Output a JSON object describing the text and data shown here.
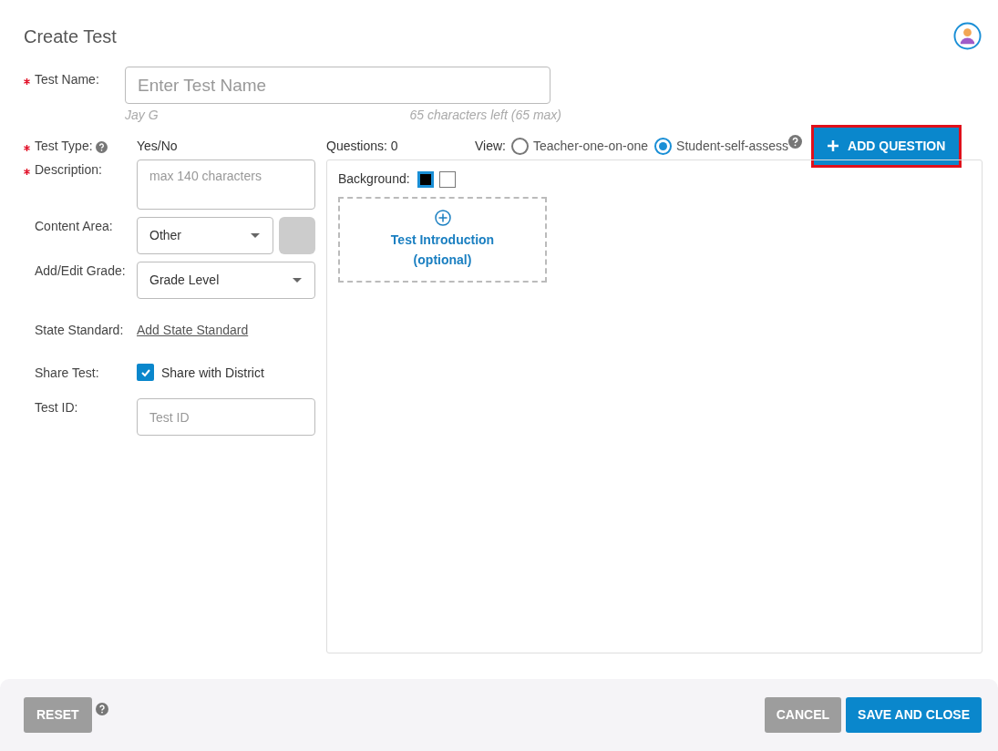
{
  "title": "Create Test",
  "test_name": {
    "label": "Test Name:",
    "required": true,
    "placeholder": "Enter Test Name",
    "author": "Jay G",
    "remaining": "65 characters left (65 max)"
  },
  "test_type": {
    "label": "Test Type:",
    "required": true,
    "value": "Yes/No"
  },
  "fields": [
    {
      "kind": "textarea",
      "label": "Description:",
      "required": true,
      "placeholder": "max 140 characters"
    },
    {
      "kind": "color-select",
      "label": "Content Area:",
      "required": false,
      "value": "Other"
    },
    {
      "kind": "select",
      "label": "Add/Edit Grade:",
      "required": false,
      "value": "Grade Level"
    },
    {
      "kind": "link",
      "label": "State Standard:",
      "required": false,
      "value": "Add State Standard"
    },
    {
      "kind": "checkbox",
      "label": "Share Test:",
      "required": false,
      "value": "Share with District",
      "checked": true
    },
    {
      "kind": "input",
      "label": "Test ID:",
      "required": false,
      "placeholder": "Test ID"
    }
  ],
  "questions": "Questions: 0",
  "view": {
    "label": "View:",
    "options": [
      {
        "label": "Teacher-one-on-one",
        "selected": false
      },
      {
        "label": "Student-self-assess",
        "selected": true
      }
    ]
  },
  "add_question": {
    "label": "ADD QUESTION",
    "highlighted": true
  },
  "background": {
    "label": "Background:",
    "options": [
      {
        "color": "#000000",
        "selected": true
      },
      {
        "color": "#ffffff",
        "selected": false
      }
    ]
  },
  "intro": {
    "title": "Test Introduction",
    "subtitle": "(optional)"
  },
  "footer": {
    "reset": "RESET",
    "cancel": "CANCEL",
    "save": "SAVE AND CLOSE"
  }
}
